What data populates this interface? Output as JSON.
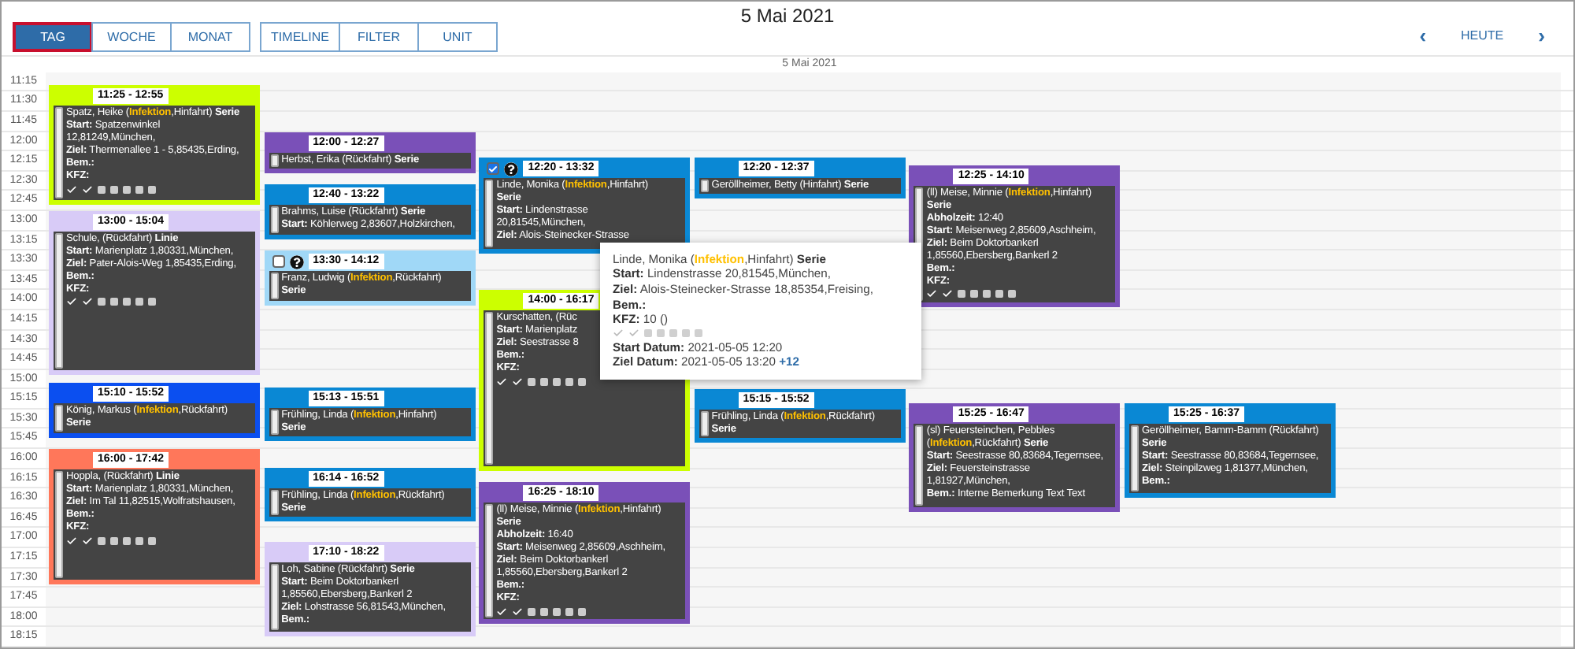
{
  "title": "5 Mai 2021",
  "view_tabs": [
    {
      "label": "TAG",
      "selected": true
    },
    {
      "label": "WOCHE",
      "selected": false
    },
    {
      "label": "MONAT",
      "selected": false
    }
  ],
  "tool_buttons": [
    "TIMELINE",
    "FILTER",
    "UNIT"
  ],
  "nav": {
    "prev": "‹",
    "today": "HEUTE",
    "next": "›"
  },
  "day_header": "5 Mai 2021",
  "times": [
    "11:15",
    "11:30",
    "11:45",
    "12:00",
    "12:15",
    "12:30",
    "12:45",
    "13:00",
    "13:15",
    "13:30",
    "13:45",
    "14:00",
    "14:15",
    "14:30",
    "14:45",
    "15:00",
    "15:15",
    "15:30",
    "15:45",
    "16:00",
    "16:15",
    "16:30",
    "16:45",
    "17:00",
    "17:15",
    "17:30",
    "17:45",
    "18:00",
    "18:15"
  ],
  "events": [
    {
      "time": "11:25 - 12:55",
      "color": "#ccff00",
      "lines": [
        "Spatz, Heike (*Infektion*,Hinfahrt) **Serie**",
        "**Start:** Spatzenwinkel",
        "12,81249,München,",
        "**Ziel:** Thermenallee 1 - 5,85435,Erding,",
        "**Bem.:**",
        "**KFZ:**"
      ],
      "steps": [
        true,
        true,
        false,
        false,
        false,
        false,
        false
      ]
    },
    {
      "time": "13:00 - 15:04",
      "color": "#d8cbf7",
      "lines": [
        "Schule, (Rückfahrt) **Linie**",
        "**Start:** Marienplatz 1,80331,München,",
        "**Ziel:** Pater-Alois-Weg 1,85435,Erding,",
        "**Bem.:**",
        "**KFZ:**"
      ],
      "steps": [
        true,
        true,
        false,
        false,
        false,
        false,
        false
      ]
    },
    {
      "time": "15:10 - 15:52",
      "color": "#0b4ff0",
      "lines": [
        "König, Markus (*Infektion*,Rückfahrt)",
        "**Serie**"
      ]
    },
    {
      "time": "16:00 - 17:42",
      "color": "#ff775a",
      "lines": [
        "Hoppla, (Rückfahrt) **Linie**",
        "**Start:** Marienplatz 1,80331,München,",
        "**Ziel:** Im Tal 11,82515,Wolfratshausen,",
        "**Bem.:**",
        "**KFZ:**"
      ],
      "steps": [
        true,
        true,
        false,
        false,
        false,
        false,
        false
      ]
    },
    {
      "time": "12:00 - 12:27",
      "color": "#7a50b8",
      "lines": [
        "Herbst, Erika (Rückfahrt) **Serie**"
      ]
    },
    {
      "time": "12:40 - 13:22",
      "color": "#0a88d4",
      "lines": [
        "Brahms, Luise (Rückfahrt) **Serie**",
        "**Start:** Köhlerweg 2,83607,Holzkirchen,"
      ]
    },
    {
      "time": "13:30 - 14:12",
      "color": "#a0d8f7",
      "checked": false,
      "lines": [
        "Franz, Ludwig (*Infektion*,Rückfahrt)",
        "**Serie**"
      ]
    },
    {
      "time": "15:13 - 15:51",
      "color": "#0a88d4",
      "lines": [
        "Frühling, Linda (*Infektion*,Hinfahrt)",
        "**Serie**"
      ]
    },
    {
      "time": "16:14 - 16:52",
      "color": "#0a88d4",
      "lines": [
        "Frühling, Linda (*Infektion*,Rückfahrt)",
        "**Serie**"
      ]
    },
    {
      "time": "17:10 - 18:22",
      "color": "#d8cbf7",
      "lines": [
        "Loh, Sabine (Rückfahrt) **Serie**",
        "**Start:** Beim Doktorbankerl",
        "1,85560,Ebersberg,Bankerl 2",
        "**Ziel:** Lohstrasse 56,81543,München,",
        "**Bem.:**"
      ]
    },
    {
      "time": "12:20 - 13:32",
      "color": "#0a88d4",
      "checked": true,
      "lines": [
        "Linde, Monika (*Infektion*,Hinfahrt)",
        "**Serie**",
        "**Start:** Lindenstrasse",
        "20,81545,München,",
        "**Ziel:** Alois-Steinecker-Strasse"
      ]
    },
    {
      "time": "14:00 - 16:17",
      "color": "#ccff00",
      "lines": [
        "Kurschatten, (Rüc",
        "**Start:** Marienplatz",
        "**Ziel:** Seestrasse 8",
        "**Bem.:**",
        "**KFZ:**"
      ],
      "steps": [
        true,
        true,
        false,
        false,
        false,
        false,
        false
      ]
    },
    {
      "time": "16:25 - 18:10",
      "color": "#7a50b8",
      "lines": [
        "(ll) Meise, Minnie (*Infektion*,Hinfahrt)",
        "**Serie**",
        "**Abholzeit:** 16:40",
        "**Start:** Meisenweg 2,85609,Aschheim,",
        "**Ziel:** Beim Doktorbankerl",
        "1,85560,Ebersberg,Bankerl 2",
        "**Bem.:**",
        "**KFZ:**"
      ],
      "steps": [
        true,
        true,
        false,
        false,
        false,
        false,
        false
      ]
    },
    {
      "time": "12:20 - 12:37",
      "color": "#0a88d4",
      "lines": [
        "Geröllheimer, Betty (Hinfahrt) **Serie**"
      ]
    },
    {
      "time": "15:15 - 15:52",
      "color": "#0a88d4",
      "lines": [
        "Frühling, Linda (*Infektion*,Rückfahrt)",
        "**Serie**"
      ]
    },
    {
      "time": "12:25 - 14:10",
      "color": "#7a50b8",
      "lines": [
        "(ll) Meise, Minnie (*Infektion*,Hinfahrt)",
        "**Serie**",
        "**Abholzeit:** 12:40",
        "**Start:** Meisenweg 2,85609,Aschheim,",
        "**Ziel:** Beim Doktorbankerl",
        "1,85560,Ebersberg,Bankerl 2",
        "**Bem.:**",
        "**KFZ:**"
      ],
      "steps": [
        true,
        true,
        false,
        false,
        false,
        false,
        false
      ]
    },
    {
      "time": "15:25 - 16:47",
      "color": "#7a50b8",
      "lines": [
        "(sl) Feuersteinchen, Pebbles",
        "(*Infektion*,Rückfahrt) **Serie**",
        "**Start:** Seestrasse 80,83684,Tegernsee,",
        "**Ziel:** Feuersteinstrasse",
        "1,81927,München,",
        "**Bem.:** Interne Bemerkung Text Text"
      ]
    },
    {
      "time": "15:25 - 16:37",
      "color": "#0a88d4",
      "lines": [
        "Geröllheimer, Bamm-Bamm (Rückfahrt)",
        "**Serie**",
        "**Start:** Seestrasse 80,83684,Tegernsee,",
        "**Ziel:** Steinpilzweg 1,81377,München,",
        "**Bem.:**"
      ]
    }
  ],
  "tooltip": {
    "lines": [
      "Linde, Monika (*Infektion*,Hinfahrt) **Serie**",
      "**Start:** Lindenstrasse 20,81545,München,",
      "**Ziel:** Alois-Steinecker-Strasse 18,85354,Freising,",
      "**Bem.:**",
      "**KFZ:** 10 ()"
    ],
    "steps": [
      true,
      true,
      false,
      false,
      false,
      false,
      false
    ],
    "dates": [
      "**Start Datum:** 2021-05-05 12:20",
      "**Ziel Datum:** 2021-05-05 13:20"
    ],
    "more": "+12"
  }
}
